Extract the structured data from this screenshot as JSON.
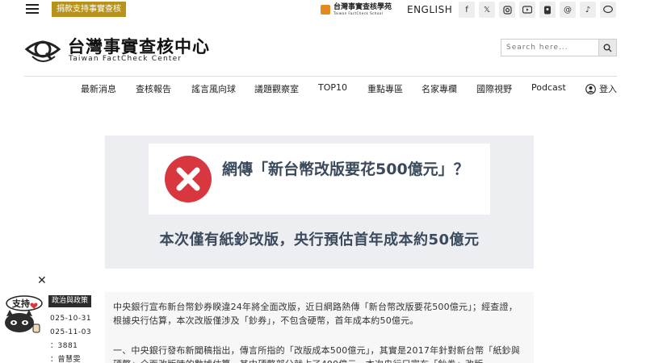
{
  "header": {
    "donate_label": "捐款支持事實查核",
    "school": {
      "name_zh": "台灣事實查核學苑",
      "name_en": "Taiwan FactCheck School"
    },
    "language_label": "ENGLISH",
    "socials": [
      "facebook-icon",
      "x-icon",
      "instagram-icon",
      "youtube-icon",
      "threads-icon",
      "tiktok-icon",
      "line-icon"
    ]
  },
  "brand": {
    "name_zh": "台灣事實查核中心",
    "name_en": "Taiwan FactCheck Center"
  },
  "search": {
    "placeholder": "Search here..."
  },
  "nav": {
    "items": [
      "最新消息",
      "查核報告",
      "謠言風向球",
      "議題觀察室",
      "TOP10",
      "重點專區",
      "名家專欄",
      "國際視野",
      "Podcast"
    ],
    "login_label": "登入"
  },
  "verdict_panel": {
    "rating_icon": "red-x-icon",
    "claim": "網傳「新台幣改版要花500億元」？",
    "finding": "本次僅有紙鈔改版，央行預估首年成本約50億元"
  },
  "side_card": {
    "mascot_label": "支持",
    "category": "政治與政策",
    "date_published": "025-10-31",
    "date_updated": "025-11-03",
    "views": "：3881",
    "author": "：曾慧雯"
  },
  "article": {
    "para1": "中央銀行宣布新台幣鈔券睽違24年將全面改版，近日網路熱傳「新台幣改版要花500億元」；經查證，根據央行估算，本次改版僅涉及「鈔券」，不包含硬幣，首年成本約50億元。",
    "para2": "一、中央銀行發布新聞稿指出，傳言所指的「改版成本500億元」，其實是2017年針對新台幣「紙鈔與硬幣」全面改版時的數據估算，其中硬幣部分就占了400億元，本次央行只宣布「鈔券」改版"
  },
  "colors": {
    "donate_bg": "#b8931a",
    "verdict_bg": "#eceef1",
    "false_red": "#d9373f",
    "heading": "#3a4a5c"
  }
}
